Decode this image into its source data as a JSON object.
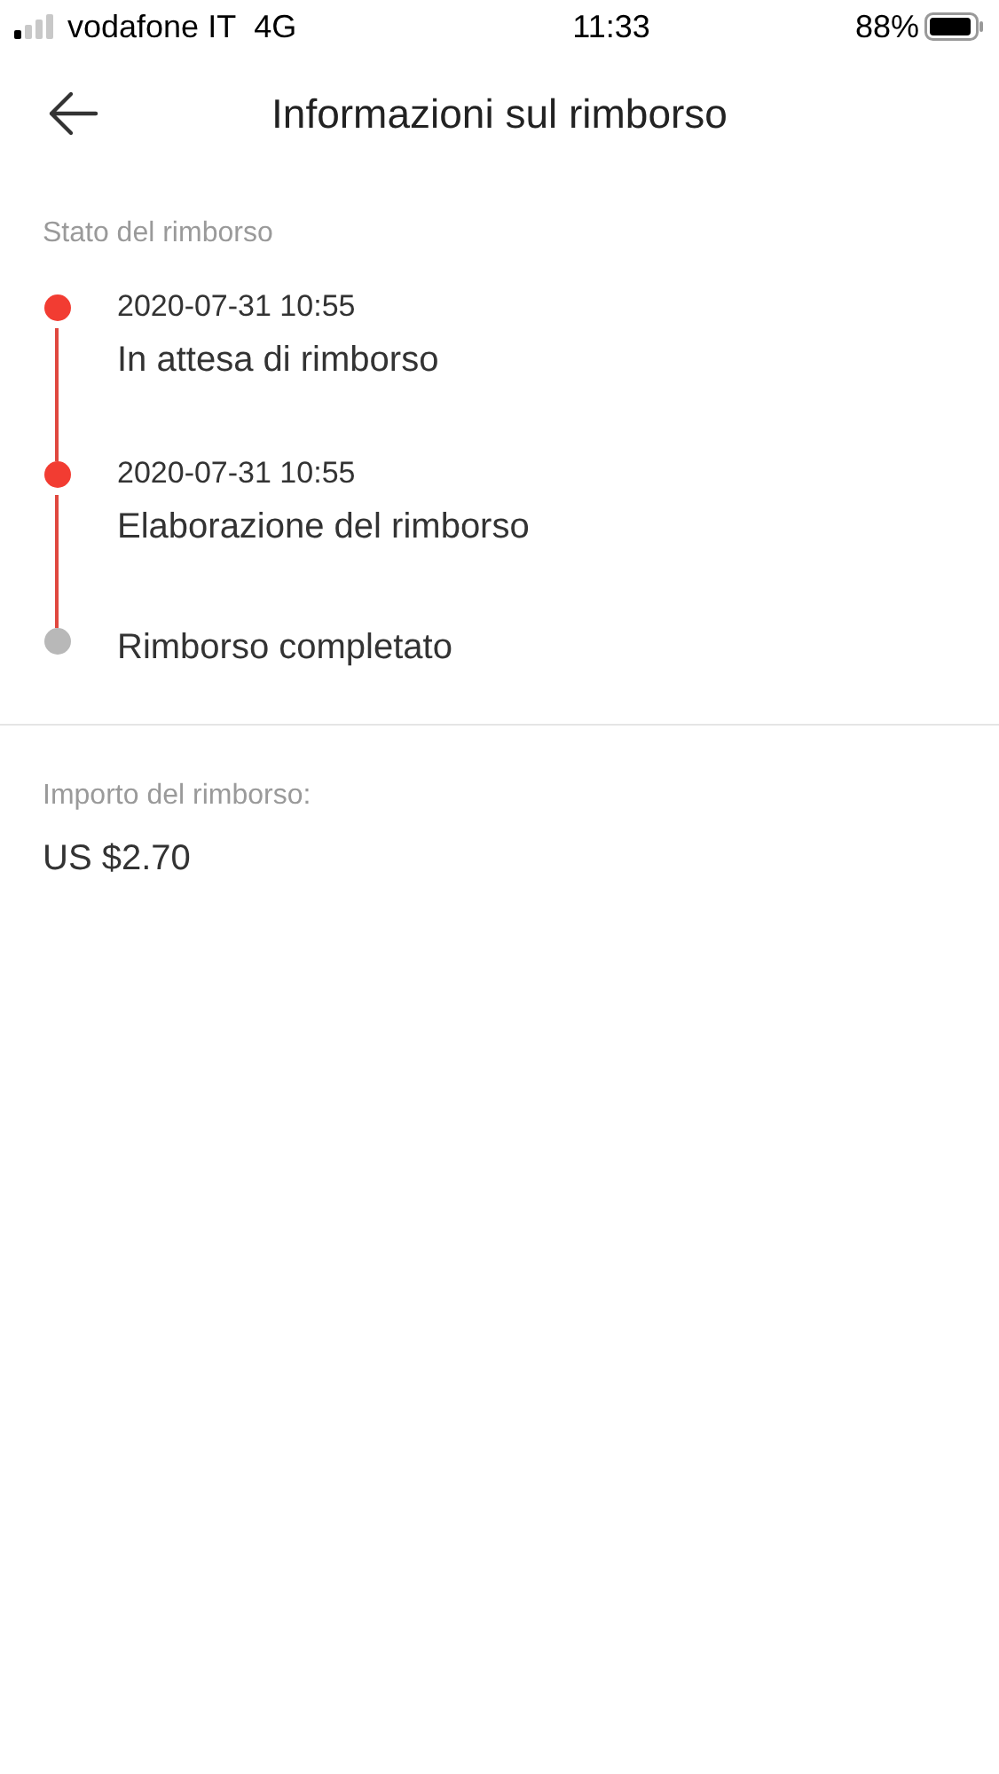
{
  "status_bar": {
    "carrier": "vodafone IT",
    "network": "4G",
    "time": "11:33",
    "battery": "88%"
  },
  "header": {
    "title": "Informazioni sul rimborso"
  },
  "refund_status": {
    "label": "Stato del rimborso",
    "steps": [
      {
        "time": "2020-07-31 10:55",
        "label": "In attesa di rimborso",
        "done": true
      },
      {
        "time": "2020-07-31 10:55",
        "label": "Elaborazione del rimborso",
        "done": true
      },
      {
        "label": "Rimborso completato",
        "done": false
      }
    ]
  },
  "refund_amount": {
    "label": "Importo del rimborso:",
    "value": "US $2.70"
  }
}
